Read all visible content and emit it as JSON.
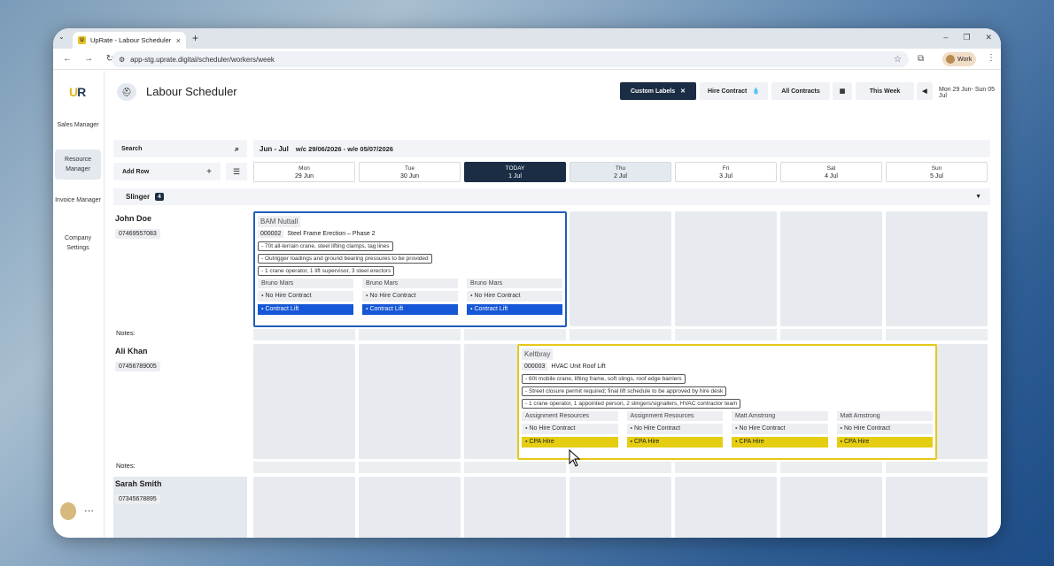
{
  "browser": {
    "tab_title": "UpRate - Labour Scheduler",
    "url": "app-stg.uprate.digital/scheduler/workers/week",
    "profile": "Work"
  },
  "sidebar": {
    "logo": "UR",
    "items": [
      "Sales Manager",
      "Resource Manager",
      "Invoice Manager",
      "Company Settings"
    ],
    "active": "Resource Manager"
  },
  "header": {
    "title": "Labour Scheduler",
    "custom_labels": "Custom Labels",
    "hire_contract": "Hire Contract",
    "all_contracts": "All Contracts",
    "this_week": "This Week",
    "week_range": "Mon 29 Jun- Sun 05 Jul"
  },
  "toolbar": {
    "search": "Search",
    "add_row": "Add Row"
  },
  "range": {
    "label": "Jun - Jul",
    "sub": "w/c 29/06/2026 - w/e 05/07/2026"
  },
  "days": [
    {
      "dow": "Mon",
      "date": "29 Jun"
    },
    {
      "dow": "Tue",
      "date": "30 Jun"
    },
    {
      "dow": "TODAY",
      "date": "1 Jul"
    },
    {
      "dow": "Thu",
      "date": "2 Jul"
    },
    {
      "dow": "Fri",
      "date": "3 Jul"
    },
    {
      "dow": "Sat",
      "date": "4 Jul"
    },
    {
      "dow": "Sun",
      "date": "5 Jul"
    }
  ],
  "group": {
    "name": "Slinger",
    "count": "4"
  },
  "notes_label": "Notes:",
  "workers": [
    {
      "name": "John Doe",
      "phone": "07469557083"
    },
    {
      "name": "Ali Khan",
      "phone": "07456789005"
    },
    {
      "name": "Sarah Smith",
      "phone": "07345678895"
    }
  ],
  "jobs": [
    {
      "client": "BAM Nuttall",
      "job_no": "000002",
      "job_title": "Steel Frame Erection – Phase 2",
      "notes": [
        "- 70t all-terrain crane, steel lifting clamps, tag lines",
        "- Outrigger loadings and ground bearing pressures to be provided",
        "- 1 crane operator, 1 lift supervisor, 3 steel erectors"
      ],
      "columns": [
        {
          "resource": "Bruno Mars",
          "hire": "No Hire Contract",
          "lift": "Contract Lift"
        },
        {
          "resource": "Bruno Mars",
          "hire": "No Hire Contract",
          "lift": "Contract Lift"
        },
        {
          "resource": "Bruno Mars",
          "hire": "No Hire Contract",
          "lift": "Contract Lift"
        }
      ],
      "color": "#1f5eb8"
    },
    {
      "client": "Keltbray",
      "job_no": "000003",
      "job_title": "HVAC Unit Roof Lift",
      "notes": [
        "- 60t mobile crane, lifting frame, soft slings, roof edge barriers",
        "- Street closure permit required; final lift schedule to be approved by hire desk",
        "- 1 crane operator, 1 appointed person, 2 slingers/signallers, HVAC contractor team"
      ],
      "columns": [
        {
          "resource": "Assignment Resources",
          "hire": "No Hire Contract",
          "lift": "CPA Hire"
        },
        {
          "resource": "Assignment Resources",
          "hire": "No Hire Contract",
          "lift": "CPA Hire"
        },
        {
          "resource": "Matt Amstrong",
          "hire": "No Hire Contract",
          "lift": "CPA Hire"
        },
        {
          "resource": "Matt Amstrong",
          "hire": "No Hire Contract",
          "lift": "CPA Hire"
        }
      ],
      "color": "#e6c81a"
    }
  ]
}
